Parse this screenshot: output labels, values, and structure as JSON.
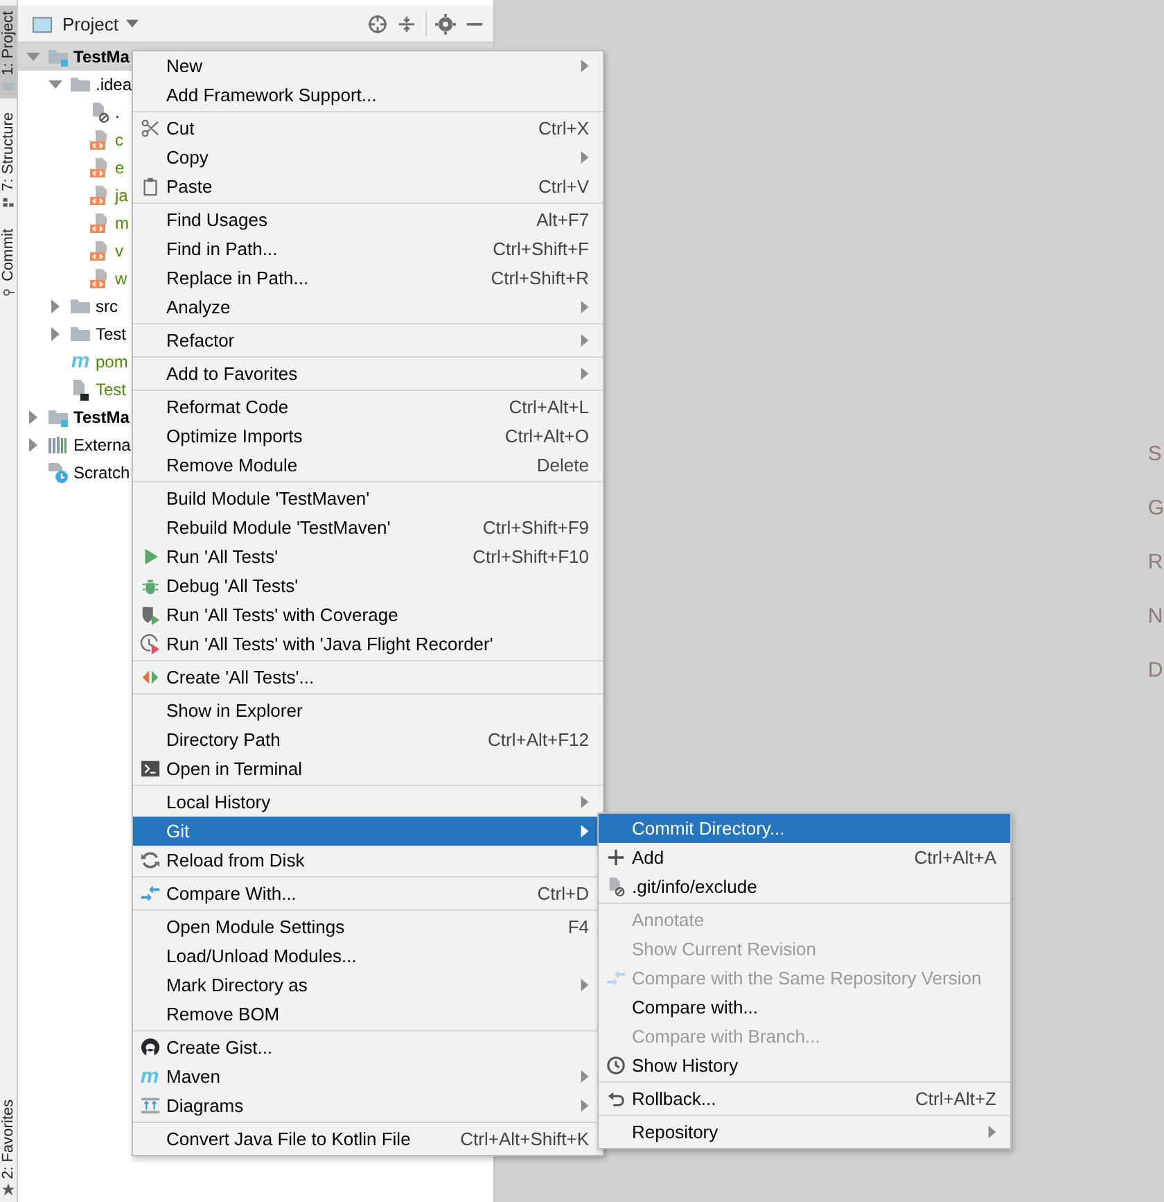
{
  "tool_strip": {
    "tabs": [
      {
        "label": "1: Project",
        "selected": true,
        "kind": "folder"
      },
      {
        "label": "7: Structure",
        "selected": false,
        "kind": "structure"
      },
      {
        "label": "Commit",
        "selected": false,
        "kind": "commit"
      }
    ],
    "bottom_tabs": [
      {
        "label": "2: Favorites",
        "selected": false,
        "kind": "star"
      }
    ]
  },
  "project_panel": {
    "title": "Project",
    "tree": [
      {
        "label": "TestMa",
        "kind": "module",
        "expanded": true,
        "selected": true,
        "children": [
          {
            "label": ".idea",
            "kind": "folder",
            "expanded": true,
            "selected": false,
            "children": [
              {
                "label": ".",
                "kind": "file-ignored",
                "selected": false
              },
              {
                "label": "c",
                "kind": "file-xml",
                "selected": false,
                "color": "#4c8a00"
              },
              {
                "label": "e",
                "kind": "file-xml",
                "selected": false,
                "color": "#4c8a00"
              },
              {
                "label": "ja",
                "kind": "file-xml",
                "selected": false,
                "color": "#4c8a00"
              },
              {
                "label": "m",
                "kind": "file-xml",
                "selected": false,
                "color": "#4c8a00"
              },
              {
                "label": "v",
                "kind": "file-xml",
                "selected": false,
                "color": "#4c8a00"
              },
              {
                "label": "w",
                "kind": "file-xml",
                "selected": false,
                "color": "#4c8a00"
              }
            ]
          },
          {
            "label": "src",
            "kind": "folder",
            "expanded": false,
            "selected": false,
            "color": "#000000"
          },
          {
            "label": "Test",
            "kind": "folder",
            "expanded": false,
            "selected": false,
            "color": "#000000"
          },
          {
            "label": "pom",
            "kind": "maven",
            "icon_text": "m",
            "selected": false,
            "color": "#4c8a00"
          },
          {
            "label": "Test",
            "kind": "file-iml",
            "selected": false,
            "color": "#4c8a00"
          }
        ]
      },
      {
        "label": "TestMa",
        "kind": "module",
        "expanded": false,
        "selected": false
      },
      {
        "label": "Externa",
        "kind": "libraries",
        "expanded": false,
        "selected": false,
        "color": "#000000"
      },
      {
        "label": "Scratch",
        "kind": "scratches",
        "selected": false,
        "color": "#000000"
      }
    ]
  },
  "editor": {
    "hints": [
      "S",
      "G",
      "R",
      "N",
      "D"
    ]
  },
  "context_menu": {
    "groups": [
      [
        {
          "label": "New",
          "submenu": true,
          "selected": false
        },
        {
          "label": "Add Framework Support...",
          "selected": false
        }
      ],
      [
        {
          "label": "Cut",
          "shortcut": "Ctrl+X",
          "kind": "scissors",
          "selected": false
        },
        {
          "label": "Copy",
          "submenu": true,
          "selected": false
        },
        {
          "label": "Paste",
          "shortcut": "Ctrl+V",
          "kind": "clipboard",
          "selected": false
        }
      ],
      [
        {
          "label": "Find Usages",
          "shortcut": "Alt+F7",
          "selected": false
        },
        {
          "label": "Find in Path...",
          "shortcut": "Ctrl+Shift+F",
          "selected": false
        },
        {
          "label": "Replace in Path...",
          "shortcut": "Ctrl+Shift+R",
          "selected": false
        },
        {
          "label": "Analyze",
          "submenu": true,
          "selected": false
        }
      ],
      [
        {
          "label": "Refactor",
          "submenu": true,
          "selected": false
        }
      ],
      [
        {
          "label": "Add to Favorites",
          "submenu": true,
          "selected": false
        }
      ],
      [
        {
          "label": "Reformat Code",
          "shortcut": "Ctrl+Alt+L",
          "selected": false
        },
        {
          "label": "Optimize Imports",
          "shortcut": "Ctrl+Alt+O",
          "selected": false
        },
        {
          "label": "Remove Module",
          "shortcut": "Delete",
          "selected": false
        }
      ],
      [
        {
          "label": "Build Module 'TestMaven'",
          "selected": false
        },
        {
          "label": "Rebuild Module 'TestMaven'",
          "shortcut": "Ctrl+Shift+F9",
          "selected": false
        },
        {
          "label": "Run 'All Tests'",
          "shortcut": "Ctrl+Shift+F10",
          "kind": "run",
          "selected": false
        },
        {
          "label": "Debug 'All Tests'",
          "kind": "debug",
          "selected": false
        },
        {
          "label": "Run 'All Tests' with Coverage",
          "kind": "coverage",
          "selected": false
        },
        {
          "label": "Run 'All Tests' with 'Java Flight Recorder'",
          "kind": "profiler",
          "selected": false
        }
      ],
      [
        {
          "label": "Create 'All Tests'...",
          "kind": "create-test",
          "selected": false
        }
      ],
      [
        {
          "label": "Show in Explorer",
          "selected": false
        },
        {
          "label": "Directory Path",
          "shortcut": "Ctrl+Alt+F12",
          "selected": false
        },
        {
          "label": "Open in Terminal",
          "kind": "terminal",
          "selected": false
        }
      ],
      [
        {
          "label": "Local History",
          "submenu": true,
          "selected": false
        },
        {
          "label": "Git",
          "submenu": true,
          "selected": true
        },
        {
          "label": "Reload from Disk",
          "kind": "reload",
          "selected": false
        }
      ],
      [
        {
          "label": "Compare With...",
          "shortcut": "Ctrl+D",
          "kind": "compare",
          "selected": false
        }
      ],
      [
        {
          "label": "Open Module Settings",
          "shortcut": "F4",
          "selected": false
        },
        {
          "label": "Load/Unload Modules...",
          "selected": false
        },
        {
          "label": "Mark Directory as",
          "submenu": true,
          "selected": false
        },
        {
          "label": "Remove BOM",
          "selected": false
        }
      ],
      [
        {
          "label": "Create Gist...",
          "kind": "github",
          "selected": false
        },
        {
          "label": "Maven",
          "submenu": true,
          "icon_text": "m",
          "selected": false
        },
        {
          "label": "Diagrams",
          "submenu": true,
          "kind": "diagrams",
          "selected": false
        }
      ],
      [
        {
          "label": "Convert Java File to Kotlin File",
          "shortcut": "Ctrl+Alt+Shift+K",
          "selected": false
        }
      ]
    ]
  },
  "git_submenu": {
    "groups": [
      [
        {
          "label": "Commit Directory...",
          "selected": true,
          "disabled": false
        },
        {
          "label": "Add",
          "shortcut": "Ctrl+Alt+A",
          "kind": "plus",
          "selected": false,
          "disabled": false
        },
        {
          "label": ".git/info/exclude",
          "kind": "file-ignored",
          "selected": false,
          "disabled": false
        }
      ],
      [
        {
          "label": "Annotate",
          "selected": false,
          "disabled": true
        },
        {
          "label": "Show Current Revision",
          "selected": false,
          "disabled": true
        },
        {
          "label": "Compare with the Same Repository Version",
          "kind": "compare",
          "selected": false,
          "disabled": true
        },
        {
          "label": "Compare with...",
          "selected": false,
          "disabled": false
        },
        {
          "label": "Compare with Branch...",
          "selected": false,
          "disabled": true
        },
        {
          "label": "Show History",
          "kind": "clock",
          "selected": false,
          "disabled": false
        }
      ],
      [
        {
          "label": "Rollback...",
          "shortcut": "Ctrl+Alt+Z",
          "kind": "rollback",
          "selected": false,
          "disabled": false
        }
      ],
      [
        {
          "label": "Repository",
          "submenu": true,
          "selected": false,
          "disabled": false
        }
      ]
    ]
  }
}
